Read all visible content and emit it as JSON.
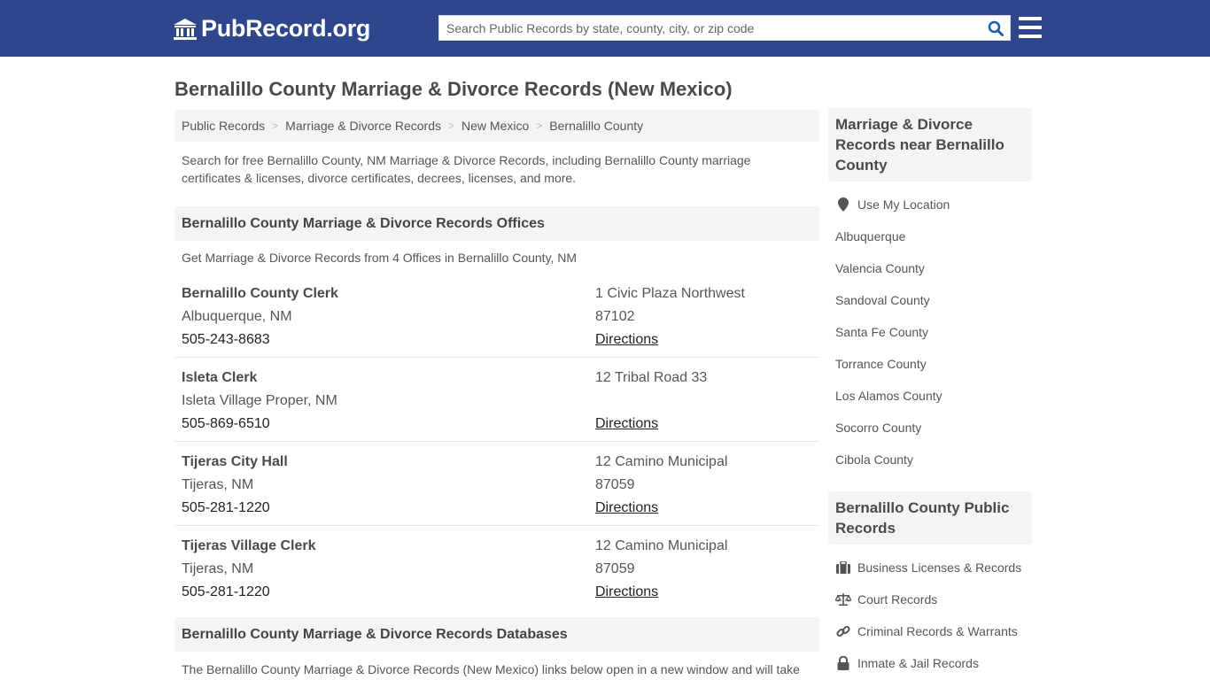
{
  "header": {
    "logo_text": "PubRecord.org",
    "search_placeholder": "Search Public Records by state, county, city, or zip code",
    "search_value": ""
  },
  "page_title": "Bernalillo County Marriage & Divorce Records (New Mexico)",
  "breadcrumb": [
    "Public Records",
    "Marriage & Divorce Records",
    "New Mexico",
    "Bernalillo County"
  ],
  "breadcrumb_separator": ">",
  "intro": "Search for free Bernalillo County, NM Marriage & Divorce Records, including Bernalillo County marriage certificates & licenses, divorce certificates, decrees, licenses, and more.",
  "offices": {
    "heading": "Bernalillo County Marriage & Divorce Records Offices",
    "subtitle": "Get Marriage & Divorce Records from 4 Offices in Bernalillo County, NM",
    "items": [
      {
        "name": "Bernalillo County Clerk",
        "city": "Albuquerque, NM",
        "phone": "505-243-8683",
        "address": "1 Civic Plaza Northwest",
        "zip": "87102",
        "directions": "Directions"
      },
      {
        "name": "Isleta Clerk",
        "city": "Isleta Village Proper, NM",
        "phone": "505-869-6510",
        "address": "12 Tribal Road 33",
        "zip": "",
        "directions": "Directions"
      },
      {
        "name": "Tijeras City Hall",
        "city": "Tijeras, NM",
        "phone": "505-281-1220",
        "address": "12 Camino Municipal",
        "zip": "87059",
        "directions": "Directions"
      },
      {
        "name": "Tijeras Village Clerk",
        "city": "Tijeras, NM",
        "phone": "505-281-1220",
        "address": "12 Camino Municipal",
        "zip": "87059",
        "directions": "Directions"
      }
    ]
  },
  "databases": {
    "heading": "Bernalillo County Marriage & Divorce Records Databases",
    "text": "The Bernalillo County Marriage & Divorce Records (New Mexico) links below open in a new window and will take"
  },
  "sidebar": {
    "nearby": {
      "heading": "Marriage & Divorce Records near Bernalillo County",
      "use_location": "Use My Location",
      "items": [
        "Albuquerque",
        "Valencia County",
        "Sandoval County",
        "Santa Fe County",
        "Torrance County",
        "Los Alamos County",
        "Socorro County",
        "Cibola County"
      ]
    },
    "public_records": {
      "heading": "Bernalillo County Public Records",
      "items": [
        {
          "label": "Business Licenses & Records",
          "icon": "briefcase-icon"
        },
        {
          "label": "Court Records",
          "icon": "scale-icon"
        },
        {
          "label": "Criminal Records & Warrants",
          "icon": "link-icon"
        },
        {
          "label": "Inmate & Jail Records",
          "icon": "lock-icon"
        }
      ]
    }
  },
  "colors": {
    "navbar": "#2e478c",
    "search_icon": "#1f5fa8",
    "panel": "#f4f4f4"
  }
}
